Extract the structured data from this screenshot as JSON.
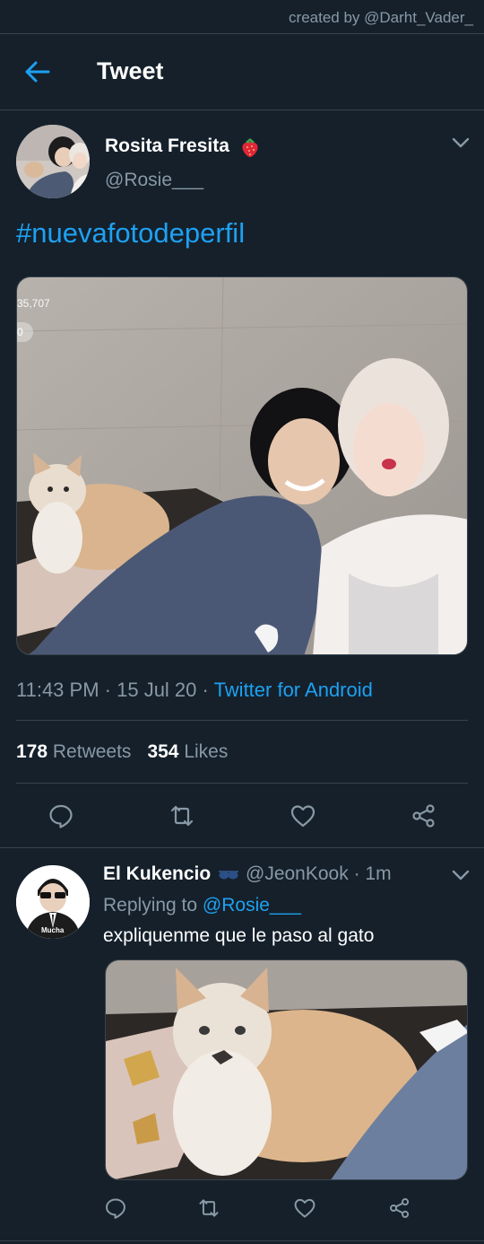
{
  "watermark": "created by @Darht_Vader_",
  "header": {
    "title": "Tweet"
  },
  "tweet": {
    "author_name": "Rosita Fresita",
    "author_handle": "@Rosie___",
    "text": "#nuevafotodeperfil",
    "media_overlay": {
      "count_text": "35,707",
      "pill_text": "0"
    },
    "time": "11:43 PM",
    "date": "15 Jul 20",
    "source": "Twitter for Android",
    "retweets_count": "178",
    "retweets_label": "Retweets",
    "likes_count": "354",
    "likes_label": "Likes"
  },
  "reply": {
    "author_name": "El Kukencio",
    "author_handle": "@JeonKook",
    "time": "1m",
    "replying_prefix": "Replying to",
    "replying_to": "@Rosie___",
    "text": "expliquenme que le paso al gato",
    "avatar_caption": "Mucha"
  },
  "icons": {
    "back": "arrow-left-icon",
    "chevron": "chevron-down-icon",
    "reply": "comment-icon",
    "retweet": "retweet-icon",
    "like": "heart-icon",
    "share": "share-icon"
  },
  "colors": {
    "background": "#15202b",
    "accent": "#1da1f2",
    "secondary_text": "#8899a6",
    "divider": "#38444d"
  }
}
